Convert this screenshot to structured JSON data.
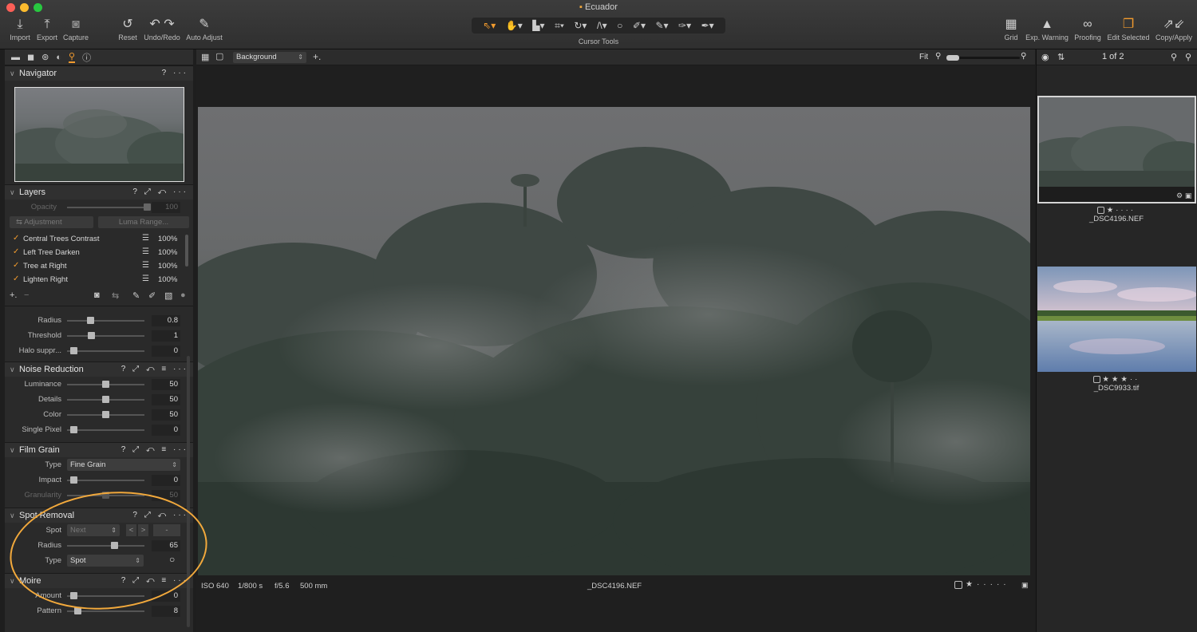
{
  "window": {
    "title": "Ecuador"
  },
  "colors": {
    "accent": "#f29b2e",
    "annotation": "#f2a93c"
  },
  "toolbar": {
    "left": [
      {
        "icon": "import-icon",
        "glyph": "⤓",
        "label": "Import"
      },
      {
        "icon": "export-icon",
        "glyph": "⤒",
        "label": "Export"
      },
      {
        "icon": "capture-icon",
        "glyph": "◙",
        "label": "Capture"
      },
      {
        "icon": "reset-icon",
        "glyph": "↺",
        "label": "Reset"
      },
      {
        "icon": "undo-redo-icon",
        "glyph": "↶ ↷",
        "label": "Undo/Redo"
      },
      {
        "icon": "auto-adjust-icon",
        "glyph": "✎",
        "label": "Auto Adjust"
      }
    ],
    "cursor_tools_label": "Cursor Tools",
    "right": [
      {
        "icon": "grid-icon",
        "glyph": "▦",
        "label": "Grid"
      },
      {
        "icon": "exposure-warning-icon",
        "glyph": "▲",
        "label": "Exp. Warning"
      },
      {
        "icon": "proofing-icon",
        "glyph": "∞",
        "label": "Proofing"
      },
      {
        "icon": "edit-selected-icon",
        "glyph": "❐",
        "label": "Edit Selected"
      },
      {
        "icon": "copy-apply-icon",
        "glyph": "⇗⇙",
        "label": "Copy/Apply"
      }
    ]
  },
  "viewer": {
    "layer_select": "Background",
    "zoom_label": "Fit",
    "info": {
      "iso": "ISO 640",
      "shutter": "1/800 s",
      "aperture": "f/5.6",
      "focal": "500 mm",
      "filename": "_DSC4196.NEF"
    }
  },
  "browser": {
    "counter": "1 of 2",
    "items": [
      {
        "filename": "_DSC4196.NEF",
        "rating": 1,
        "selected": true
      },
      {
        "filename": "_DSC9933.tif",
        "rating": 3,
        "selected": false
      }
    ]
  },
  "panels": {
    "navigator": {
      "title": "Navigator",
      "tools": "? ···"
    },
    "layers": {
      "title": "Layers",
      "tools": "? ⤢ ↶ ···",
      "opacity_label": "Opacity",
      "opacity_value": "100",
      "adjustment_select": "Adjustment",
      "luma_button": "Luma Range...",
      "items": [
        {
          "name": "Central Trees Contrast",
          "value": "100%"
        },
        {
          "name": "Left Tree Darken",
          "value": "100%"
        },
        {
          "name": "Tree at Right",
          "value": "100%"
        },
        {
          "name": "Lighten Right",
          "value": "100%"
        }
      ]
    },
    "clarity_rows": [
      {
        "label": "Radius",
        "value": "0.8",
        "pos": 0.28
      },
      {
        "label": "Threshold",
        "value": "1",
        "pos": 0.3
      },
      {
        "label": "Halo suppr...",
        "value": "0",
        "pos": 0.05
      }
    ],
    "noise_reduction": {
      "title": "Noise Reduction",
      "tools": "? ⤢ ↶ ≡ ···",
      "rows": [
        {
          "label": "Luminance",
          "value": "50",
          "pos": 0.5
        },
        {
          "label": "Details",
          "value": "50",
          "pos": 0.5
        },
        {
          "label": "Color",
          "value": "50",
          "pos": 0.5
        },
        {
          "label": "Single Pixel",
          "value": "0",
          "pos": 0.05
        }
      ]
    },
    "film_grain": {
      "title": "Film Grain",
      "tools": "? ⤢ ↶ ≡ ···",
      "type_label": "Type",
      "type_value": "Fine Grain",
      "impact_label": "Impact",
      "impact_value": "0",
      "impact_pos": 0.05,
      "granularity_label": "Granularity",
      "granularity_value": "50",
      "granularity_pos": 0.5
    },
    "spot_removal": {
      "title": "Spot Removal",
      "tools": "? ⤢ ↶ ···",
      "spot_label": "Spot",
      "spot_value": "Next",
      "prev_btn": "<",
      "next_btn": ">",
      "minus_btn": "-",
      "radius_label": "Radius",
      "radius_value": "65",
      "radius_pos": 0.63,
      "type_label": "Type",
      "type_value": "Spot"
    },
    "moire": {
      "title": "Moire",
      "tools": "? ⤢ ↶ ≡ ···",
      "rows": [
        {
          "label": "Amount",
          "value": "0",
          "pos": 0.05
        },
        {
          "label": "Pattern",
          "value": "8",
          "pos": 0.1
        }
      ]
    }
  }
}
